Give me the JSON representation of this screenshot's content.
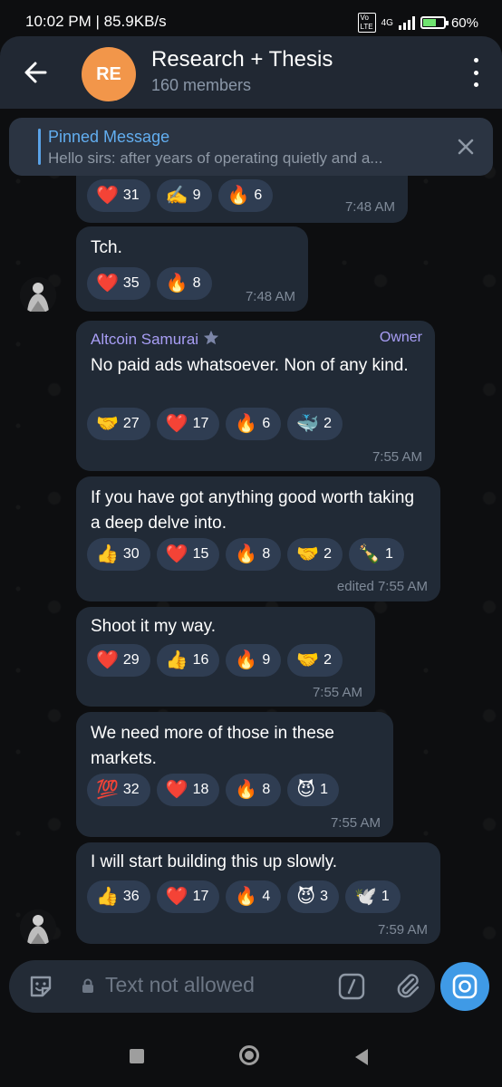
{
  "status": {
    "time": "10:02 PM",
    "speed": "85.9KB/s",
    "network": "4G",
    "battery": "60%"
  },
  "header": {
    "avatar_initials": "RE",
    "title": "Research + Thesis",
    "subtitle": "160 members"
  },
  "pinned": {
    "title": "Pinned Message",
    "text": "Hello sirs: after years of operating quietly and a..."
  },
  "messages": [
    {
      "id": "m1",
      "text": "",
      "time": "7:48 AM",
      "reactions": [
        {
          "emoji": "❤️",
          "count": "31"
        },
        {
          "emoji": "✍️",
          "count": "9"
        },
        {
          "emoji": "🔥",
          "count": "6"
        }
      ]
    },
    {
      "id": "m2",
      "text": "Tch.",
      "time": "7:48 AM",
      "reactions": [
        {
          "emoji": "❤️",
          "count": "35"
        },
        {
          "emoji": "🔥",
          "count": "8"
        }
      ]
    },
    {
      "id": "m3",
      "sender": "Altcoin Samurai",
      "role": "Owner",
      "text": "No paid ads whatsoever. Non of any kind.",
      "time": "7:55 AM",
      "reactions": [
        {
          "emoji": "🤝",
          "count": "27"
        },
        {
          "emoji": "❤️",
          "count": "17"
        },
        {
          "emoji": "🔥",
          "count": "6"
        },
        {
          "emoji": "🐳",
          "count": "2"
        }
      ]
    },
    {
      "id": "m4",
      "text": "If you have got anything good worth taking a deep delve into.",
      "time": "edited 7:55 AM",
      "reactions": [
        {
          "emoji": "👍",
          "count": "30"
        },
        {
          "emoji": "❤️",
          "count": "15"
        },
        {
          "emoji": "🔥",
          "count": "8"
        },
        {
          "emoji": "🤝",
          "count": "2"
        },
        {
          "emoji": "🍾",
          "count": "1"
        }
      ]
    },
    {
      "id": "m5",
      "text": "Shoot it my way.",
      "time": "7:55 AM",
      "reactions": [
        {
          "emoji": "❤️",
          "count": "29"
        },
        {
          "emoji": "👍",
          "count": "16"
        },
        {
          "emoji": "🔥",
          "count": "9"
        },
        {
          "emoji": "🤝",
          "count": "2"
        }
      ]
    },
    {
      "id": "m6",
      "text": "We need more of those in these markets.",
      "time": "7:55 AM",
      "reactions": [
        {
          "emoji": "💯",
          "count": "32"
        },
        {
          "emoji": "❤️",
          "count": "18"
        },
        {
          "emoji": "🔥",
          "count": "8"
        },
        {
          "emoji": "😈",
          "count": "1"
        }
      ]
    },
    {
      "id": "m7",
      "text": "I will start building this up slowly.",
      "time": "7:59 AM",
      "reactions": [
        {
          "emoji": "👍",
          "count": "36"
        },
        {
          "emoji": "❤️",
          "count": "17"
        },
        {
          "emoji": "🔥",
          "count": "4"
        },
        {
          "emoji": "😈",
          "count": "3"
        },
        {
          "emoji": "🕊️",
          "count": "1"
        }
      ]
    }
  ],
  "input": {
    "placeholder": "Text not allowed"
  },
  "icons": {
    "back": "arrow-left-icon",
    "menu": "more-vertical-icon",
    "close": "close-icon",
    "sticker": "sticker-icon",
    "lock": "lock-icon",
    "command": "slash-command-icon",
    "attach": "paperclip-icon",
    "camera": "camera-icon",
    "verified_star": "star-icon"
  },
  "colors": {
    "accent": "#3f9ae6",
    "sender": "#a89ef5",
    "avatar": "#f2964a",
    "bubble": "#212a36",
    "reaction": "#2f3d52"
  }
}
